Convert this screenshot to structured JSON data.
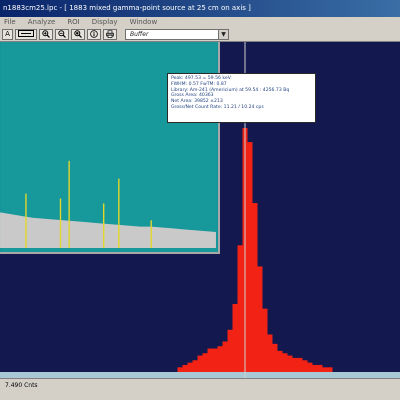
{
  "window": {
    "title": "n1883cm25.lpc - [ 1883 mixed gamma-point source at 25 cm on axis ]"
  },
  "menu": [
    "File",
    "Analyze",
    "ROI",
    "Display",
    "Window"
  ],
  "toolbar": {
    "buttons": [
      {
        "label": "A",
        "icon": "text-a-icon"
      },
      {
        "label": "",
        "icon": "spectrum-view-icon"
      },
      {
        "label": "",
        "icon": "zoom-in-icon"
      },
      {
        "label": "",
        "icon": "zoom-out-icon"
      },
      {
        "label": "",
        "icon": "zoom-fit-icon"
      },
      {
        "label": "",
        "icon": "info-icon"
      },
      {
        "label": "",
        "icon": "print-icon"
      }
    ],
    "buffer_select": "Buffer"
  },
  "tooltip": {
    "lines": [
      "Peak: 497.53 = 59.56 keV",
      "FWHM: 0.57  FwTM: 0.87",
      "Library: Am-241 (Americium) at 59.54 : 4256.73 Bq",
      "Gross Area: 40363",
      "Net Area: 39852 ±213",
      "Gross/Net Count Rate: 11.21 / 10.24 cps"
    ]
  },
  "status": {
    "text": "7.490  Cnts"
  },
  "colors": {
    "plot_background": "#13184e",
    "inset_background": "#17989a",
    "baseline_continuum": "#a9c8d6",
    "peak_fill": "#f22314",
    "inset_continuum": "#c9c9c9",
    "inset_lines": "#e2d72a"
  },
  "chart_data": [
    {
      "type": "bar",
      "x": [
        -13,
        -12,
        -11,
        -10,
        -9,
        -8,
        -7,
        -6,
        -5,
        -4,
        -3,
        -2,
        -1,
        0,
        1,
        2,
        3,
        4,
        5,
        6,
        7,
        8,
        9,
        10,
        11,
        12,
        13,
        14,
        15,
        16,
        17
      ],
      "values": [
        2,
        3,
        4,
        5,
        7,
        8,
        10,
        10,
        11,
        13,
        18,
        29,
        54,
        104,
        98,
        72,
        45,
        27,
        16,
        12,
        9,
        8,
        7,
        6,
        6,
        5,
        4,
        3,
        3,
        2,
        2
      ],
      "ylim": [
        0,
        110
      ],
      "grid": false
    },
    {
      "type": "line",
      "x": [
        0,
        0.05,
        0.1,
        0.15,
        0.2,
        0.25,
        0.3,
        0.35,
        0.4,
        0.45,
        0.5,
        0.55,
        0.6,
        0.65,
        0.7,
        0.75,
        0.8,
        0.85,
        0.9,
        0.95,
        1.0
      ],
      "values": [
        40,
        38,
        36,
        34,
        33,
        32,
        31,
        30,
        29,
        28,
        27,
        26,
        25,
        24,
        24,
        23,
        22,
        21,
        20,
        19,
        18
      ],
      "lines": [
        {
          "x": 0.12,
          "height": 55
        },
        {
          "x": 0.28,
          "height": 50
        },
        {
          "x": 0.32,
          "height": 88
        },
        {
          "x": 0.48,
          "height": 45
        },
        {
          "x": 0.55,
          "height": 70
        },
        {
          "x": 0.7,
          "height": 28
        }
      ],
      "ylim": [
        0,
        100
      ],
      "grid": false
    }
  ]
}
